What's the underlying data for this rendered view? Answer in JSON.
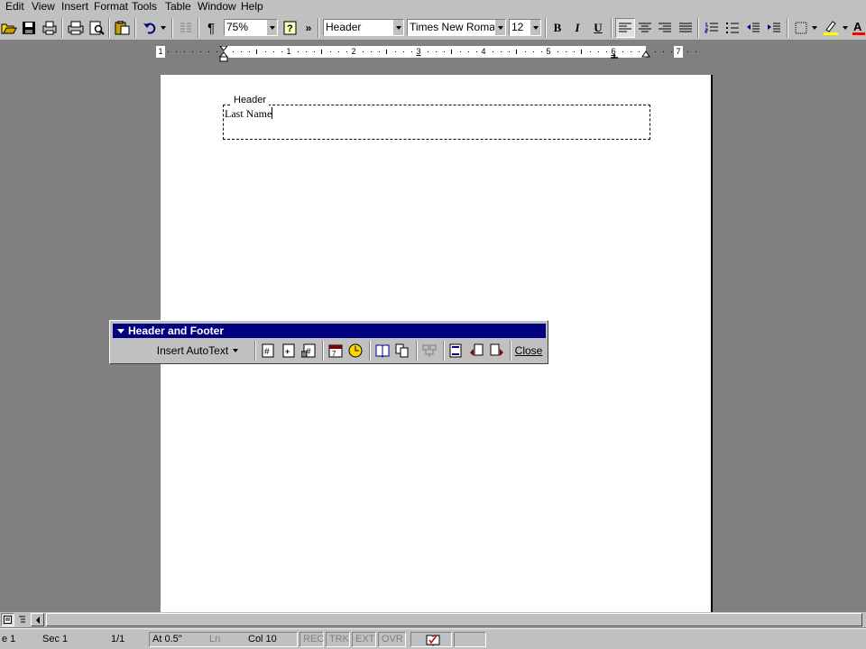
{
  "menubar": {
    "items": [
      "Edit",
      "View",
      "Insert",
      "Format",
      "Tools",
      "Table",
      "Window",
      "Help"
    ]
  },
  "toolbar": {
    "zoom": "75%",
    "style": "Header",
    "font": "Times New Roman",
    "size": "12",
    "bold": "B",
    "italic": "I",
    "underline": "U",
    "overflow": "»",
    "show_hide": "¶",
    "help": "?"
  },
  "ruler": {
    "numbers": [
      "1",
      "1",
      "2",
      "3",
      "4",
      "5",
      "6",
      "7"
    ]
  },
  "document": {
    "header_label": "Header",
    "header_text": "Last Name"
  },
  "hf_toolbar": {
    "title": "Header and Footer",
    "insert_autotext": "Insert AutoText",
    "close": "Close"
  },
  "statusbar": {
    "page": "e 1",
    "section": "Sec 1",
    "pages": "1/1",
    "at": "At 0.5\"",
    "ln": "Ln",
    "col": "Col 10",
    "rec": "REC",
    "trk": "TRK",
    "ext": "EXT",
    "ovr": "OVR"
  },
  "colors": {
    "titlebar": "#000080",
    "chrome": "#c0c0c0",
    "workspace": "#808080",
    "highlight": "#ffff00",
    "font_color": "#ff0000"
  }
}
